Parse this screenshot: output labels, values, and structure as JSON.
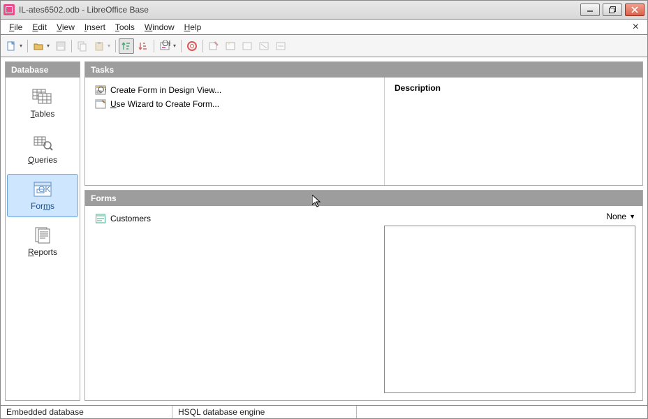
{
  "title": "IL-ates6502.odb - LibreOffice Base",
  "menus": {
    "file": "File",
    "edit": "Edit",
    "view": "View",
    "insert": "Insert",
    "tools": "Tools",
    "window": "Window",
    "help": "Help"
  },
  "sidebar": {
    "header": "Database",
    "items": [
      {
        "label": "Tables",
        "key": "T"
      },
      {
        "label": "Queries",
        "key": "Q"
      },
      {
        "label": "Forms",
        "key": "F"
      },
      {
        "label": "Reports",
        "key": "R"
      }
    ],
    "selected": 2
  },
  "tasks": {
    "header": "Tasks",
    "items": [
      "Create Form in Design View...",
      "Use Wizard to Create Form..."
    ],
    "description_label": "Description"
  },
  "forms": {
    "header": "Forms",
    "items": [
      "Customers"
    ],
    "preview_mode": "None"
  },
  "status": {
    "db_type": "Embedded database",
    "engine": "HSQL database engine"
  }
}
